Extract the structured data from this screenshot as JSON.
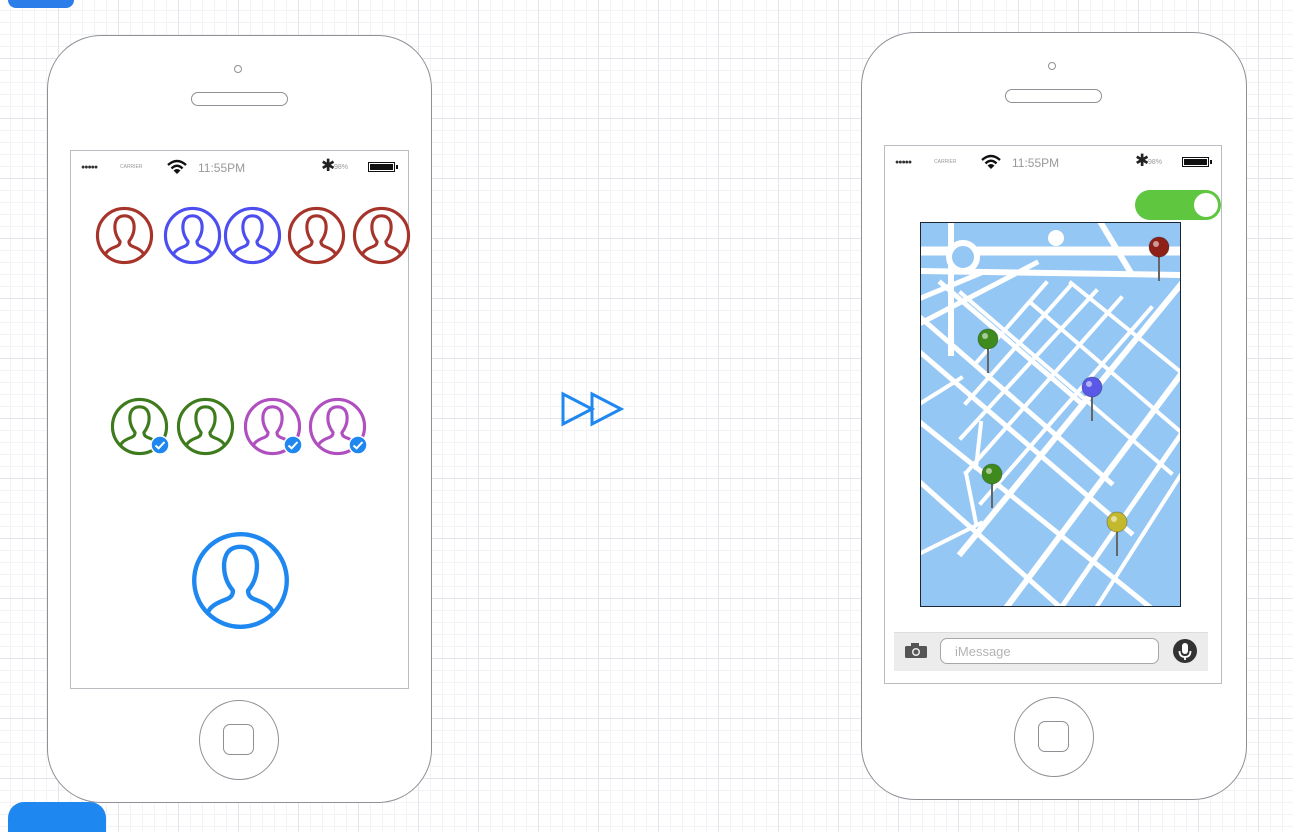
{
  "status_bar": {
    "signal": "●●●●●",
    "carrier": "CARRIER",
    "time": "11:55PM",
    "battery": "98%",
    "bluetooth": "✱"
  },
  "left_phone": {
    "avatar_rows": [
      {
        "row": "top",
        "avatars": [
          {
            "color": "#a7342b"
          },
          {
            "color": "#4d4ef0"
          },
          {
            "color": "#4d4ef0"
          },
          {
            "color": "#a7342b"
          },
          {
            "color": "#a7342b"
          }
        ]
      },
      {
        "row": "middle",
        "avatars": [
          {
            "color": "#3e7b1d",
            "checked": true
          },
          {
            "color": "#3e7b1d",
            "checked": false
          },
          {
            "color": "#b04fc0",
            "checked": true
          },
          {
            "color": "#b04fc0",
            "checked": true
          }
        ]
      },
      {
        "row": "bottom",
        "avatars": [
          {
            "color": "#1e88f0"
          }
        ]
      }
    ],
    "check_badge_color": "#1e88f0"
  },
  "right_phone": {
    "toggle": {
      "on": true,
      "color": "#5ec63f"
    },
    "map": {
      "water_color": "#94c7f4",
      "pins": [
        {
          "color": "#8f2018"
        },
        {
          "color": "#3e8a1c"
        },
        {
          "color": "#5a58e6"
        },
        {
          "color": "#3e8a1c"
        },
        {
          "color": "#c4b82c"
        }
      ]
    },
    "message_input": {
      "placeholder": "iMessage",
      "value": ""
    }
  },
  "center_icon": "fast-forward",
  "accent_color": "#1e88f0"
}
